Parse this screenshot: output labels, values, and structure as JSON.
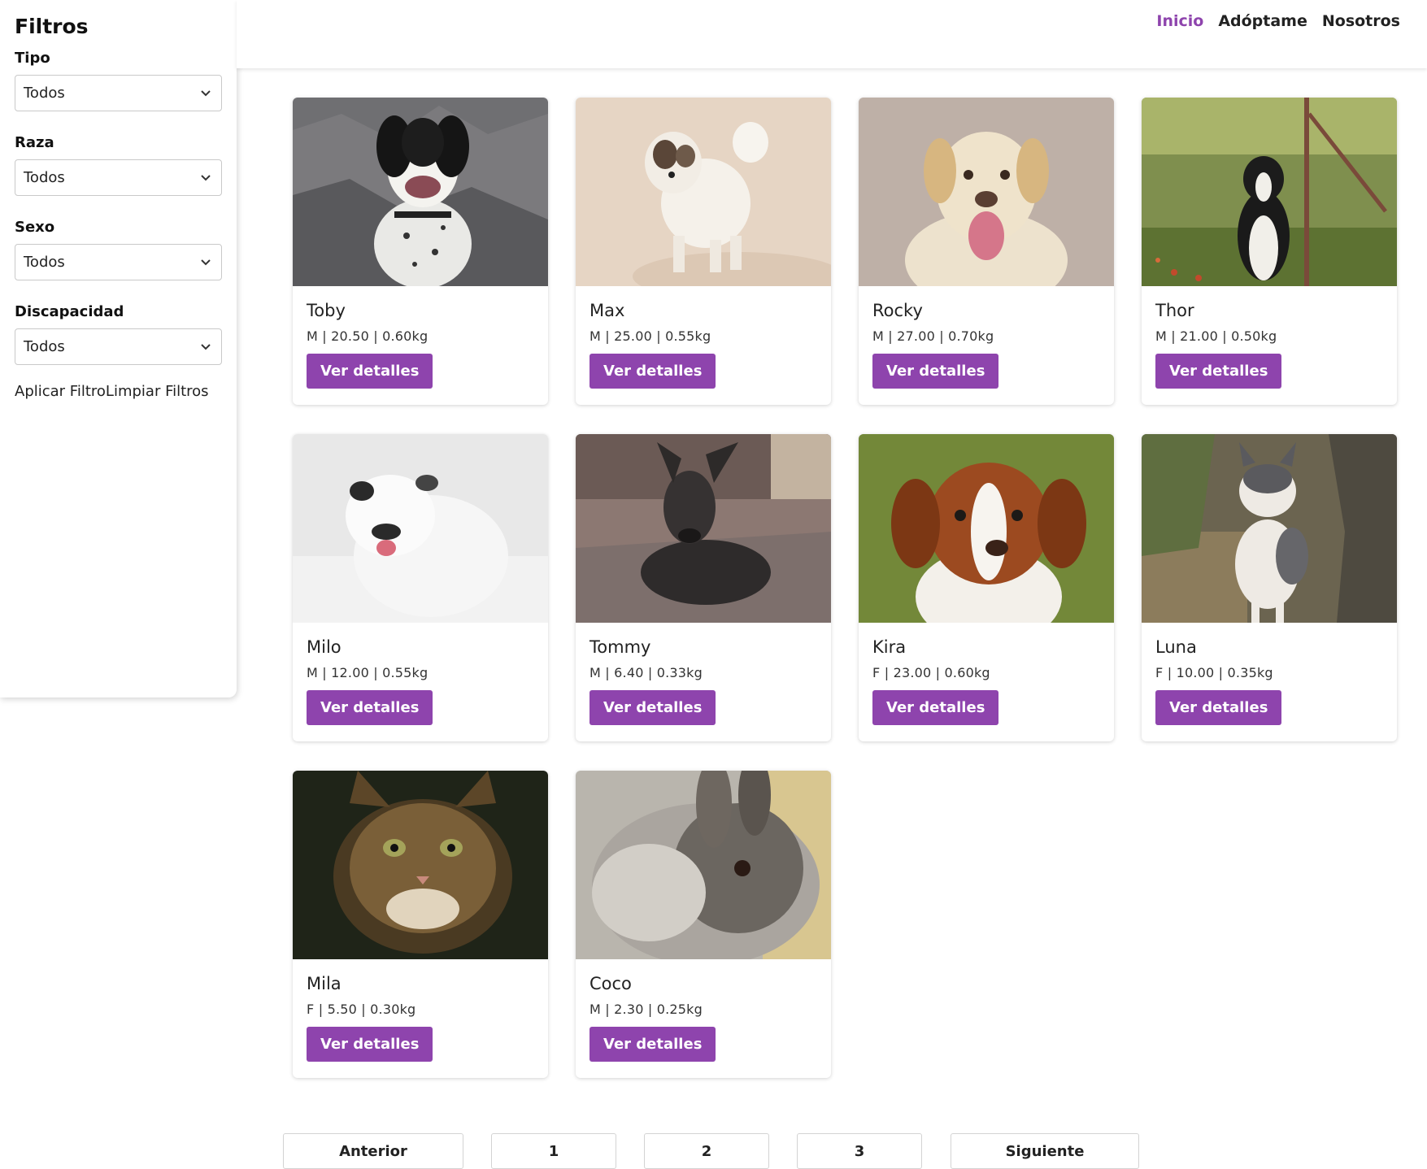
{
  "sidebar": {
    "title": "Filtros",
    "filters": [
      {
        "label": "Tipo",
        "value": "Todos"
      },
      {
        "label": "Raza",
        "value": "Todos"
      },
      {
        "label": "Sexo",
        "value": "Todos"
      },
      {
        "label": "Discapacidad",
        "value": "Todos"
      }
    ],
    "apply_label": "Aplicar Filtro",
    "clear_label": "Limpiar Filtros"
  },
  "nav": {
    "items": [
      {
        "label": "Inicio",
        "active": true
      },
      {
        "label": "Adóptame",
        "active": false
      },
      {
        "label": "Nosotros",
        "active": false
      }
    ],
    "accent_color": "#8e44ad"
  },
  "pets": [
    {
      "name": "Toby",
      "meta": "M | 20.50 | 0.60kg",
      "button": "Ver detalles",
      "photo": "dog-spotted"
    },
    {
      "name": "Max",
      "meta": "M | 25.00 | 0.55kg",
      "button": "Ver detalles",
      "photo": "dog-fluffy-white"
    },
    {
      "name": "Rocky",
      "meta": "M | 27.00 | 0.70kg",
      "button": "Ver detalles",
      "photo": "dog-labrador"
    },
    {
      "name": "Thor",
      "meta": "M | 21.00 | 0.50kg",
      "button": "Ver detalles",
      "photo": "dog-border-collie"
    },
    {
      "name": "Milo",
      "meta": "M | 12.00 | 0.55kg",
      "button": "Ver detalles",
      "photo": "dog-bulldog"
    },
    {
      "name": "Tommy",
      "meta": "M | 6.40 | 0.33kg",
      "button": "Ver detalles",
      "photo": "dog-dark-lying"
    },
    {
      "name": "Kira",
      "meta": "F | 23.00 | 0.60kg",
      "button": "Ver detalles",
      "photo": "dog-puppy-brown"
    },
    {
      "name": "Luna",
      "meta": "F | 10.00 | 0.35kg",
      "button": "Ver detalles",
      "photo": "cat-white-gray"
    },
    {
      "name": "Mila",
      "meta": "F | 5.50 | 0.30kg",
      "button": "Ver detalles",
      "photo": "cat-tabby"
    },
    {
      "name": "Coco",
      "meta": "M | 2.30 | 0.25kg",
      "button": "Ver detalles",
      "photo": "rabbit-gray"
    }
  ],
  "pagination": {
    "prev": "Anterior",
    "pages": [
      "1",
      "2",
      "3"
    ],
    "next": "Siguiente"
  }
}
